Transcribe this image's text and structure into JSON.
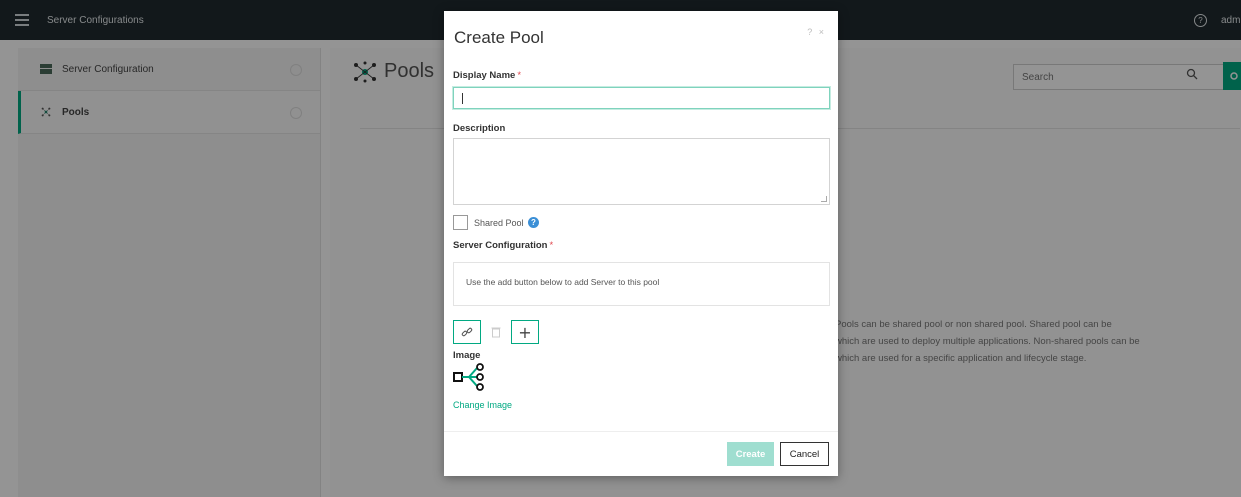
{
  "topbar": {
    "title": "Server Configurations",
    "help_icon": "?",
    "user": "adm"
  },
  "sidebar": {
    "items": [
      {
        "label": "Server Configuration",
        "icon": "server-config-icon",
        "active": false
      },
      {
        "label": "Pools",
        "icon": "pool-icon",
        "active": true
      }
    ]
  },
  "main": {
    "title": "Pools",
    "search_placeholder": "Search",
    "info_lines": [
      "Pools can be shared pool or non shared pool. Shared pool can be",
      "which are used to deploy multiple applications. Non-shared pools can be",
      "which are used for a specific application and lifecycle stage."
    ]
  },
  "dialog": {
    "title": "Create Pool",
    "tools": "? ×",
    "display_name_label": "Display Name",
    "required_mark": "*",
    "display_name_value": "",
    "description_label": "Description",
    "description_value": "",
    "shared_pool_label": "Shared Pool",
    "shared_pool_info": "?",
    "server_config_label": "Server Configuration",
    "server_config_hint": "Use the add button below to add Server to this pool",
    "image_label": "Image",
    "change_image": "Change Image",
    "create_label": "Create",
    "cancel_label": "Cancel",
    "add_symbol": "+"
  },
  "colors": {
    "accent": "#01a982",
    "topbar": "#1f2a30",
    "required": "#e0474e",
    "info": "#3b8fd6"
  }
}
